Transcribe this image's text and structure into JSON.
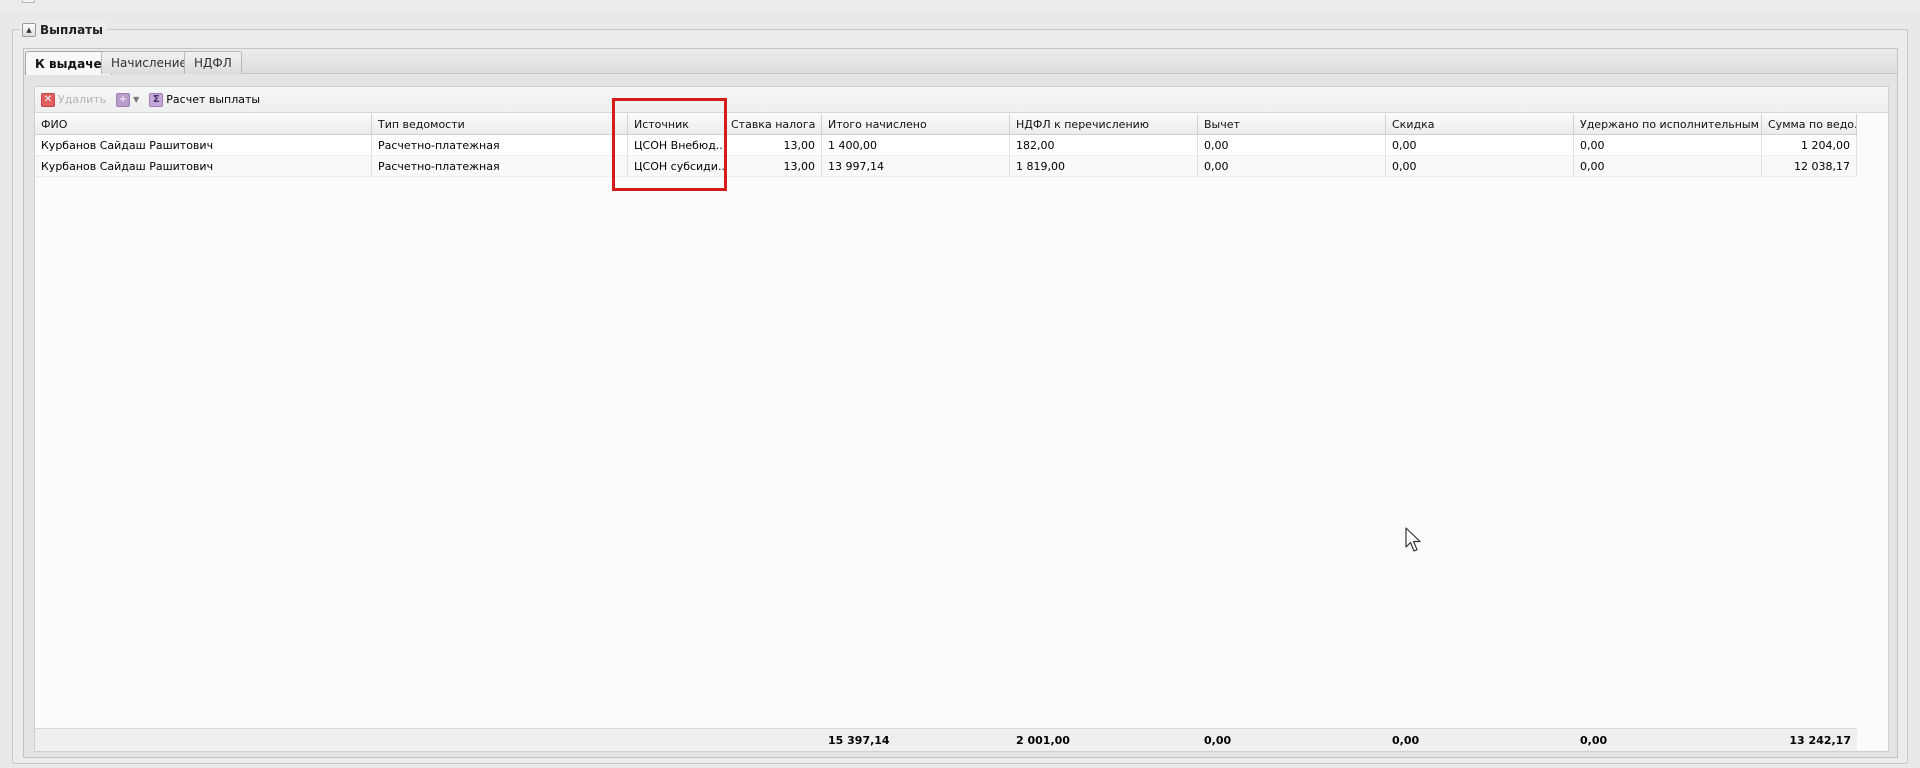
{
  "section": {
    "title": "Выплаты"
  },
  "tabs": [
    {
      "label": "К выдаче",
      "active": true
    },
    {
      "label": "Начисление",
      "active": false
    },
    {
      "label": "НДФЛ",
      "active": false
    }
  ],
  "toolbar": {
    "delete_label": "Удалить",
    "calc_label": "Расчет выплаты"
  },
  "columns": [
    "ФИО",
    "Тип ведомости",
    "Источник",
    "Ставка налога",
    "Итого начислено",
    "НДФЛ к перечислению",
    "Вычет",
    "Скидка",
    "Удержано по исполнительным л...",
    "Сумма по ведо..."
  ],
  "rows": [
    [
      "Курбанов Сайдаш Рашитович",
      "Расчетно-платежная",
      "ЦСОН Внебюд...",
      "13,00",
      "1 400,00",
      "182,00",
      "0,00",
      "0,00",
      "0,00",
      "1 204,00"
    ],
    [
      "Курбанов Сайдаш Рашитович",
      "Расчетно-платежная",
      "ЦСОН субсиди...",
      "13,00",
      "13 997,14",
      "1 819,00",
      "0,00",
      "0,00",
      "0,00",
      "12 038,17"
    ]
  ],
  "totals": {
    "itogo": "15 397,14",
    "ndfl": "2 001,00",
    "vychet": "0,00",
    "skidka": "0,00",
    "uderzhano": "0,00",
    "summa": "13 242,17"
  },
  "colors": {
    "highlight": "#d41c1c"
  }
}
